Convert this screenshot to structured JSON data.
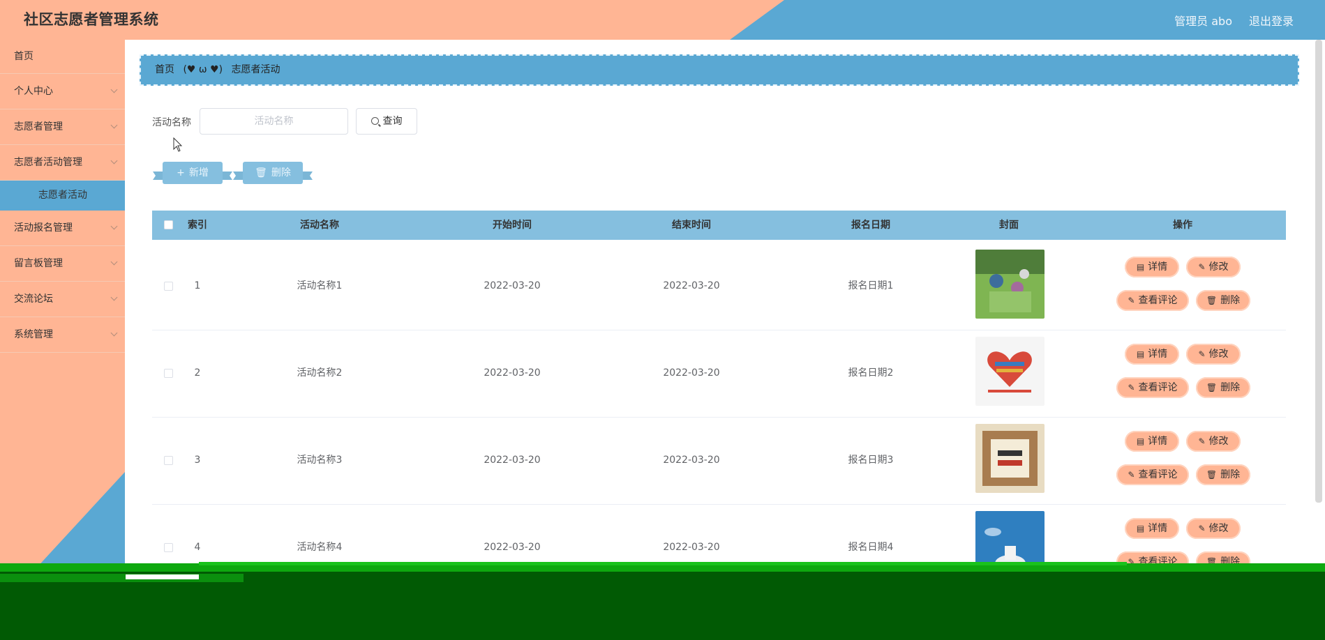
{
  "header": {
    "title": "社区志愿者管理系统",
    "user": "管理员 abo",
    "logout": "退出登录"
  },
  "sidebar": {
    "items": [
      {
        "label": "首页",
        "has_arrow": false
      },
      {
        "label": "个人中心",
        "has_arrow": true
      },
      {
        "label": "志愿者管理",
        "has_arrow": true
      },
      {
        "label": "志愿者活动管理",
        "has_arrow": true
      },
      {
        "label": "志愿者活动",
        "sub": true
      },
      {
        "label": "活动报名管理",
        "has_arrow": true
      },
      {
        "label": "留言板管理",
        "has_arrow": true
      },
      {
        "label": "交流论坛",
        "has_arrow": true
      },
      {
        "label": "系统管理",
        "has_arrow": true
      }
    ]
  },
  "breadcrumb": {
    "home": "首页",
    "separator": "(♥ ω ♥)",
    "current": "志愿者活动"
  },
  "search": {
    "label": "活动名称",
    "placeholder": "活动名称",
    "button": "查询"
  },
  "toolbar": {
    "add": "新增",
    "delete": "删除"
  },
  "table": {
    "headers": [
      "索引",
      "活动名称",
      "开始时间",
      "结束时间",
      "报名日期",
      "封面",
      "操作"
    ],
    "rows": [
      {
        "index": "1",
        "name": "活动名称1",
        "start": "2022-03-20",
        "end": "2022-03-20",
        "signup": "报名日期1",
        "cover": "photo-people-outdoors"
      },
      {
        "index": "2",
        "name": "活动名称2",
        "start": "2022-03-20",
        "end": "2022-03-20",
        "signup": "报名日期2",
        "cover": "book-heart-poster"
      },
      {
        "index": "3",
        "name": "活动名称3",
        "start": "2022-03-20",
        "end": "2022-03-20",
        "signup": "报名日期3",
        "cover": "book-poster"
      },
      {
        "index": "4",
        "name": "活动名称4",
        "start": "2022-03-20",
        "end": "2022-03-20",
        "signup": "报名日期4",
        "cover": "blue-sky-poster"
      }
    ],
    "actions": {
      "detail": "详情",
      "edit": "修改",
      "comments": "查看评论",
      "delete": "删除"
    }
  },
  "colors": {
    "salmon": "#ffb594",
    "blue": "#5aa8d3",
    "light_blue": "#85bfdf",
    "glitch_green": "#015a04"
  }
}
